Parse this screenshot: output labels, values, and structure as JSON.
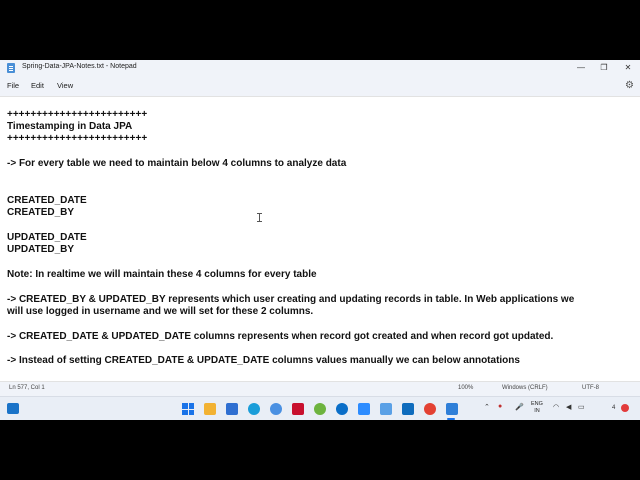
{
  "window": {
    "title": "Spring-Data-JPA-Notes.txt - Notepad",
    "minimize": "—",
    "maximize": "❐",
    "close": "✕"
  },
  "menu": {
    "file": "File",
    "edit": "Edit",
    "view": "View"
  },
  "editor": {
    "lines": [
      "++++++++++++++++++++++++",
      "Timestamping in Data JPA",
      "++++++++++++++++++++++++",
      "-> For every table we need to maintain below 4 columns to analyze data",
      "CREATED_DATE",
      "CREATED_BY",
      "UPDATED_DATE",
      "UPDATED_BY",
      "Note: In realtime we will maintain these 4 columns for every table",
      "-> CREATED_BY & UPDATED_BY represents which user creating and updating records in table. In Web applications we",
      "will use logged in username and we will set for these 2 columns.",
      "-> CREATED_DATE & UPDATED_DATE columns represents when record got created and when record got updated.",
      "-> Instead of setting CREATED_DATE & UPDATE_DATE columns values manually we can below annotations"
    ]
  },
  "status": {
    "position": "Ln 577, Col 1",
    "zoom": "100%",
    "line_ending": "Windows (CRLF)",
    "encoding": "UTF-8"
  },
  "taskbar": {
    "lang_line1": "ENG",
    "lang_line2": "IN",
    "notification_count": "4",
    "icons": [
      "widgets-icon",
      "windows-start-icon",
      "file-explorer-icon",
      "store-icon",
      "edge-icon",
      "chrome-alt-icon",
      "mcafee-icon",
      "spring-tool-icon",
      "dell-icon",
      "zoom-icon",
      "snip-icon",
      "outlook-icon",
      "chrome-icon",
      "spring-tool-2-icon",
      "vscode-icon",
      "notepad-icon"
    ],
    "colors": {
      "accent": "#1a73e8"
    }
  }
}
